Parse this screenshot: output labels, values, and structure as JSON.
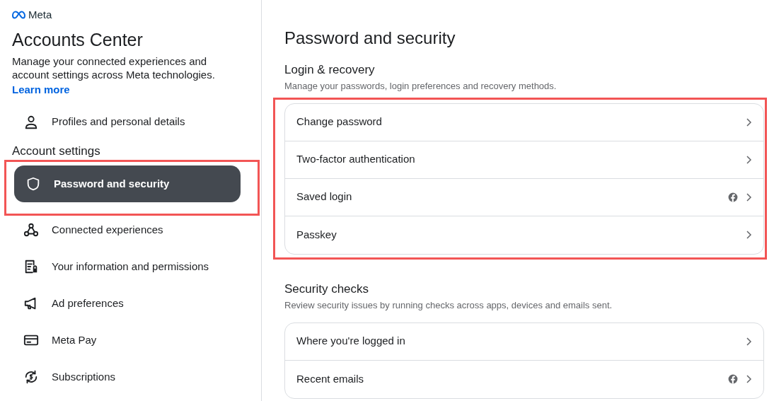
{
  "brand": {
    "name": "Meta"
  },
  "sidebar": {
    "title": "Accounts Center",
    "description": "Manage your connected experiences and account settings across Meta technologies.",
    "link": "Learn more",
    "top_items": [
      {
        "label": "Profiles and personal details",
        "selected": false
      }
    ],
    "section_title": "Account settings",
    "items": [
      {
        "label": "Password and security",
        "selected": true,
        "highlighted": true
      },
      {
        "label": "Connected experiences",
        "selected": false,
        "highlighted": false
      },
      {
        "label": "Your information and permissions",
        "selected": false,
        "highlighted": false
      },
      {
        "label": "Ad preferences",
        "selected": false,
        "highlighted": false
      },
      {
        "label": "Meta Pay",
        "selected": false,
        "highlighted": false
      },
      {
        "label": "Subscriptions",
        "selected": false,
        "highlighted": false
      }
    ]
  },
  "main": {
    "title": "Password and security",
    "sections": [
      {
        "title": "Login & recovery",
        "subtitle": "Manage your passwords, login preferences and recovery methods.",
        "highlighted": true,
        "rows": [
          {
            "label": "Change password",
            "facebook": false
          },
          {
            "label": "Two-factor authentication",
            "facebook": false
          },
          {
            "label": "Saved login",
            "facebook": true
          },
          {
            "label": "Passkey",
            "facebook": false
          }
        ]
      },
      {
        "title": "Security checks",
        "subtitle": "Review security issues by running checks across apps, devices and emails sent.",
        "highlighted": false,
        "rows": [
          {
            "label": "Where you're logged in",
            "facebook": false
          },
          {
            "label": "Recent emails",
            "facebook": true
          }
        ]
      }
    ]
  }
}
